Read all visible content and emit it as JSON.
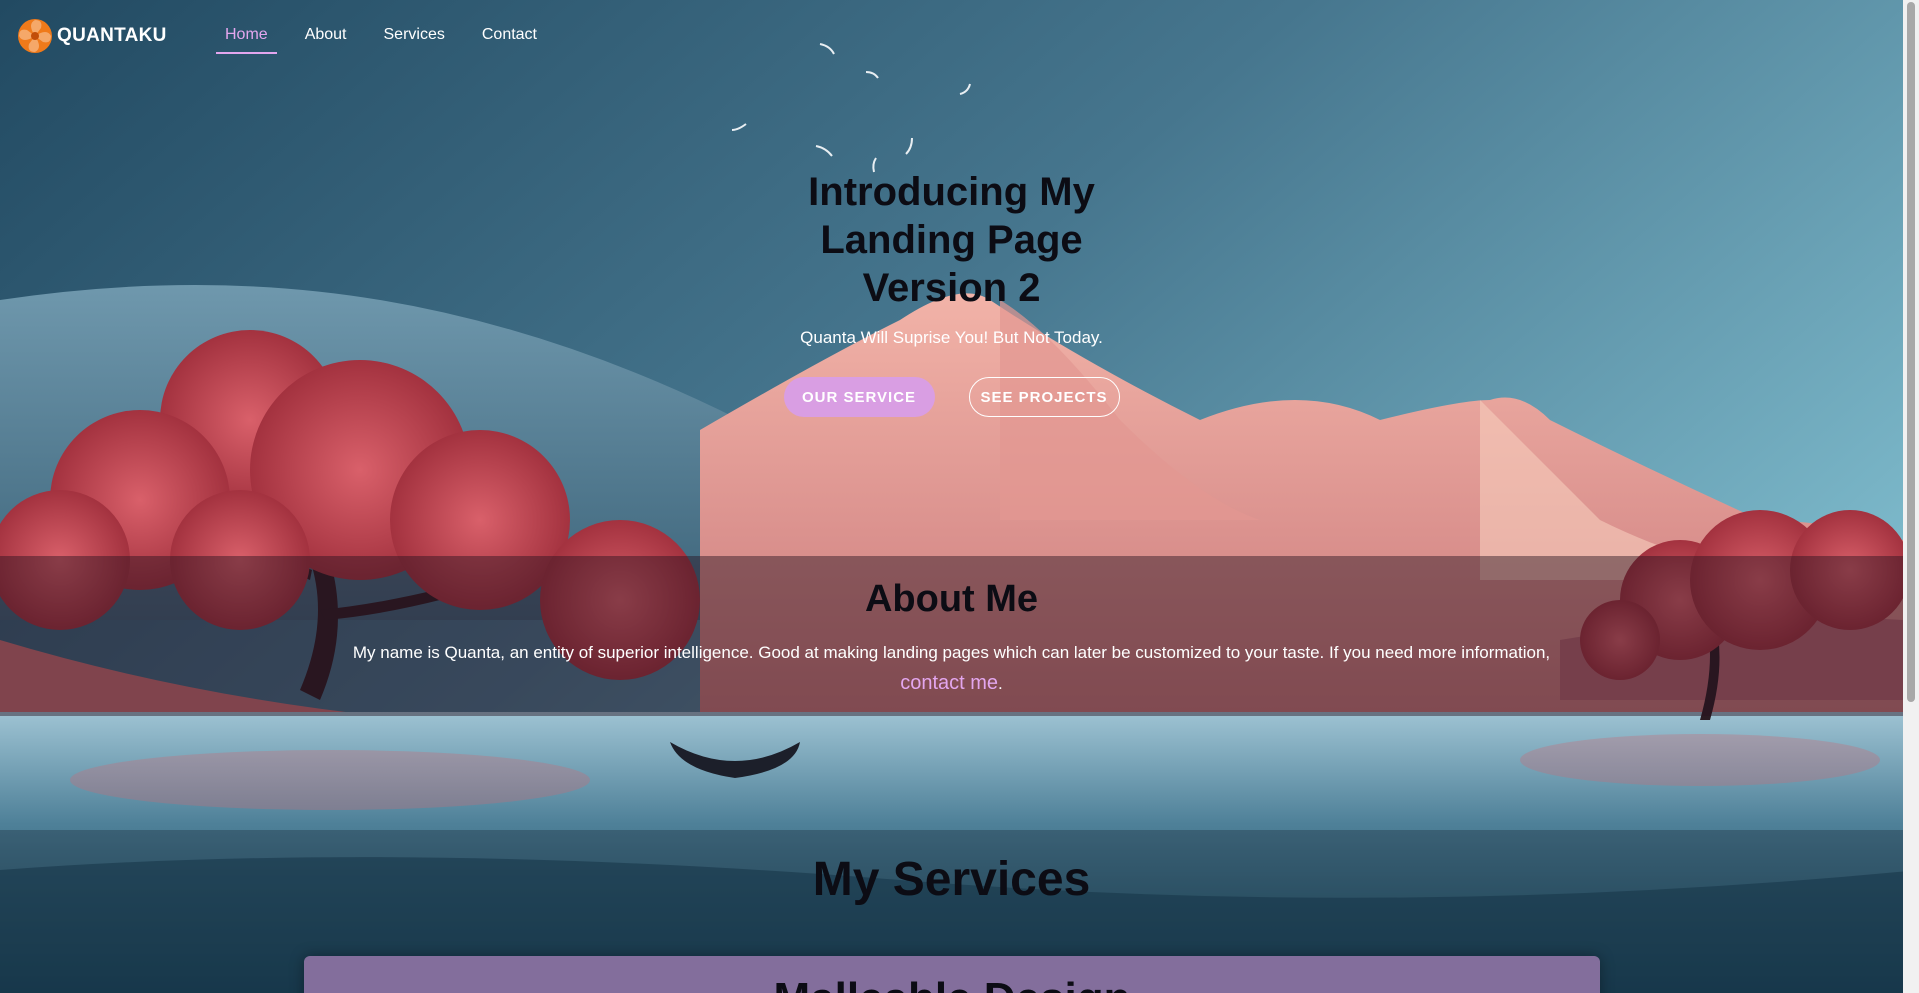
{
  "brand": {
    "name": "QUANTAKU",
    "logo_icon": "orange-swirl-logo-icon"
  },
  "nav": {
    "items": [
      {
        "label": "Home",
        "active": true
      },
      {
        "label": "About",
        "active": false
      },
      {
        "label": "Services",
        "active": false
      },
      {
        "label": "Contact",
        "active": false
      }
    ]
  },
  "hero": {
    "title": "Introducing My Landing Page Version 2",
    "subtitle": "Quanta Will Suprise You! But Not Today.",
    "primary_button": "OUR SERVICE",
    "secondary_button": "SEE PROJECTS"
  },
  "about": {
    "title": "About Me",
    "text": "My name is Quanta, an entity of superior intelligence. Good at making landing pages which can later be customized to your taste. If you need more information,",
    "link_label": "contact me",
    "trailing": "."
  },
  "services": {
    "title": "My Services",
    "card_title": "Malleable Design"
  },
  "colors": {
    "accent": "#d99ee3",
    "accent_text": "#e3a6ee",
    "sky": "#4f86a0",
    "mountain": "#eca39a",
    "tree": "#b8404c",
    "heading": "#0c0c14"
  }
}
